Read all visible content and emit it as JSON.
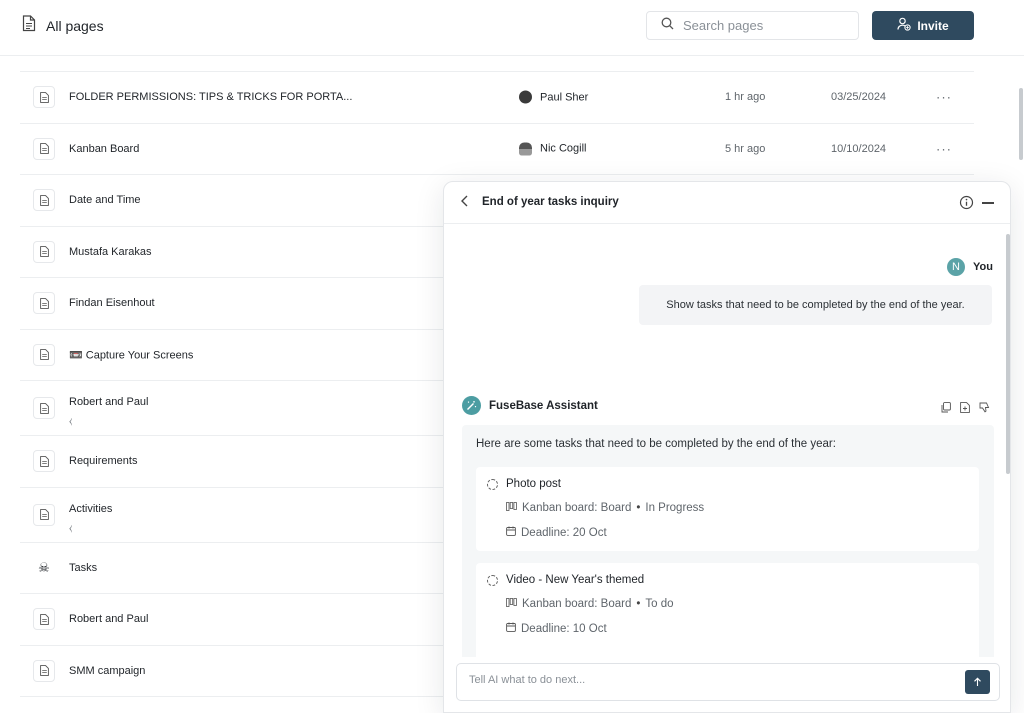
{
  "header": {
    "title": "All pages",
    "search_placeholder": "Search pages",
    "invite_label": "Invite"
  },
  "pages": [
    {
      "name": "FOLDER PERMISSIONS: TIPS & TRICKS FOR PORTA...",
      "owner": "Paul Sher",
      "edited": "1 hr ago",
      "created": "03/25/2024",
      "more": "···"
    },
    {
      "name": "Kanban Board",
      "owner": "Nic Cogill",
      "edited": "5 hr ago",
      "created": "10/10/2024",
      "more": "···"
    },
    {
      "name": "Date and Time"
    },
    {
      "name": "Mustafa Karakas"
    },
    {
      "name": "Findan Eisenhout"
    },
    {
      "name": "📼 Capture Your Screens"
    },
    {
      "name": "Robert and Paul",
      "sub": "⧼"
    },
    {
      "name": "Requirements"
    },
    {
      "name": "Activities",
      "sub": "⧼"
    },
    {
      "name": "Tasks"
    },
    {
      "name": "Robert and Paul"
    },
    {
      "name": "SMM campaign"
    }
  ],
  "chat": {
    "title": "End of year tasks inquiry",
    "user": {
      "initial": "N",
      "name": "You",
      "message": "Show tasks that need to be completed by the end of the year."
    },
    "assistant": {
      "name": "FuseBase Assistant",
      "intro": "Here are some tasks that need to be completed by the end of the year:",
      "tasks": [
        {
          "title": "Photo post",
          "board": "Kanban board: Board",
          "status": "In Progress",
          "deadline": "Deadline: 20 Oct"
        },
        {
          "title": "Video - New Year's themed",
          "board": "Kanban board: Board",
          "status": "To do",
          "deadline": "Deadline: 10 Oct"
        }
      ]
    },
    "composer_placeholder": "Tell AI what to do next..."
  },
  "colors": {
    "primary": "#2f4a5f",
    "assistant_accent": "#4c9da2",
    "user_avatar": "#5ba3a7"
  }
}
